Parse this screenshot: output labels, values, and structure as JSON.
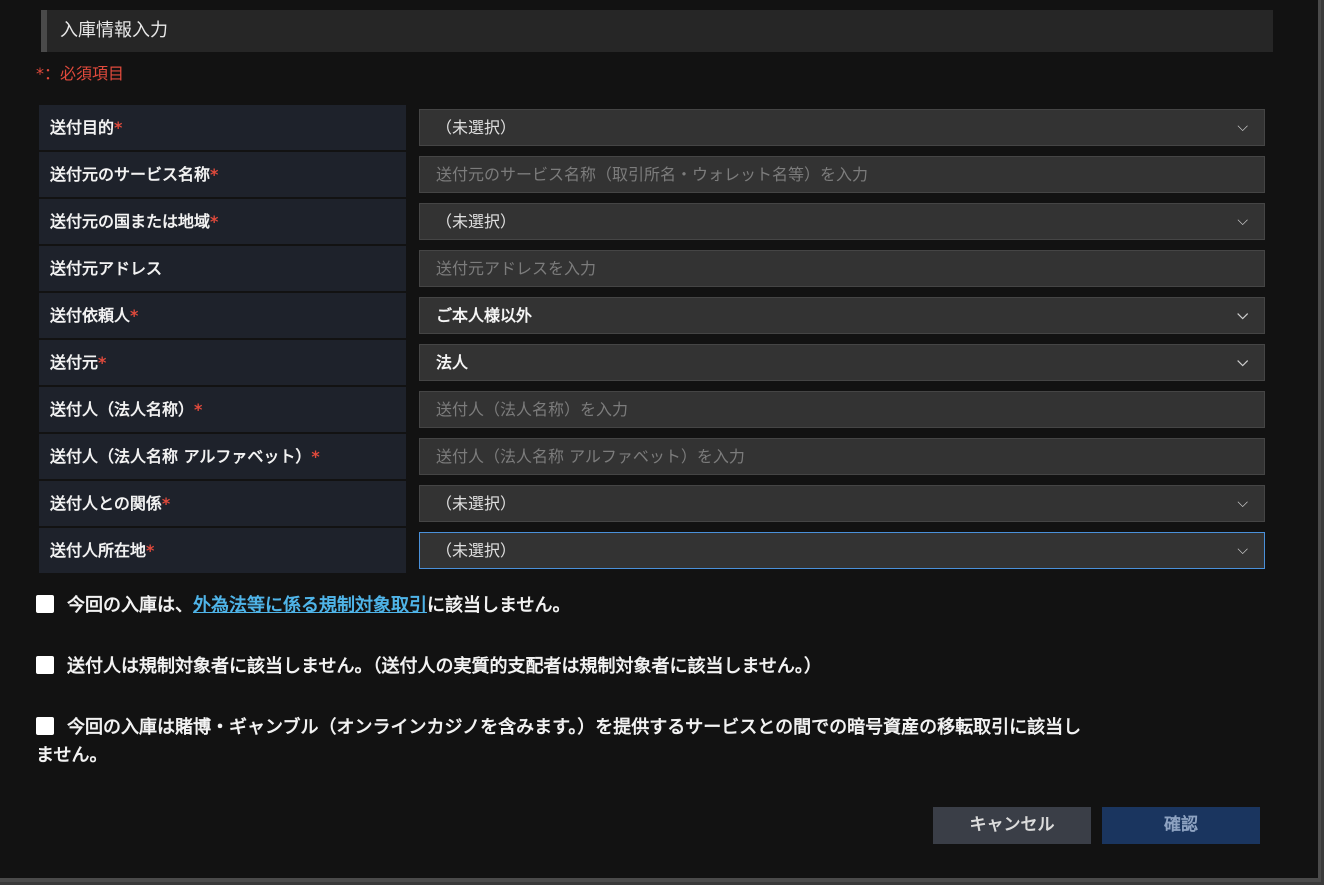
{
  "section": {
    "title": "入庫情報入力",
    "required_note": "*：必須項目"
  },
  "form": {
    "rows": [
      {
        "label": "送付目的",
        "required": "*",
        "value": "（未選択）",
        "type": "select"
      },
      {
        "label": "送付元のサービス名称",
        "required": "*",
        "placeholder": "送付元のサービス名称（取引所名・ウォレット名等）を入力",
        "type": "input"
      },
      {
        "label": "送付元の国または地域",
        "required": "*",
        "value": "（未選択）",
        "type": "select"
      },
      {
        "label": "送付元アドレス",
        "required": "",
        "placeholder": "送付元アドレスを入力",
        "type": "input"
      },
      {
        "label": "送付依頼人",
        "required": "*",
        "value": "ご本人様以外",
        "type": "select"
      },
      {
        "label": "送付元",
        "required": "*",
        "value": "法人",
        "type": "select"
      },
      {
        "label": "送付人（法人名称）",
        "required": "*",
        "placeholder": "送付人（法人名称）を入力",
        "type": "input"
      },
      {
        "label": "送付人（法人名称 アルファベット）",
        "required": "*",
        "placeholder": "送付人（法人名称 アルファベット）を入力",
        "type": "input"
      },
      {
        "label": "送付人との関係",
        "required": "*",
        "value": "（未選択）",
        "type": "select"
      },
      {
        "label": "送付人所在地",
        "required": "*",
        "value": "（未選択）",
        "type": "select"
      }
    ]
  },
  "checks": {
    "c1_before": "今回の入庫は、",
    "c1_link": "外為法等に係る規制対象取引",
    "c1_after": "に該当しません。",
    "c2": "送付人は規制対象者に該当しません。（送付人の実質的支配者は規制対象者に該当しません。）",
    "c3_line1": "今回の入庫は賭博・ギャンブル（オンラインカジノを含みます。）を提供するサービスとの間での暗号資産の移転取引に該当し",
    "c3_line2": "ません。"
  },
  "buttons": {
    "cancel": "キャンセル",
    "confirm": "確認"
  },
  "icons": {
    "dropdown": "chevron-down-icon"
  },
  "colors": {
    "required": "#e04a3c",
    "link": "#4fb4e8",
    "focus": "#4a90d9",
    "confirm_button": "#1a355f"
  }
}
